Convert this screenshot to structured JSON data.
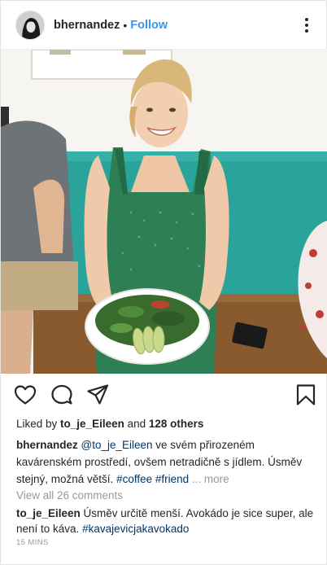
{
  "header": {
    "username": "bhernandez",
    "separator": "•",
    "follow_label": "Follow",
    "avatar_icon": "profile-avatar",
    "more_icon": "more-options-icon"
  },
  "photo": {
    "subject": "post-photo"
  },
  "actions": {
    "like_icon": "heart-icon",
    "comment_icon": "comment-icon",
    "share_icon": "send-icon",
    "save_icon": "bookmark-icon"
  },
  "likes": {
    "prefix": "Liked by ",
    "user": "to_je_Eileen",
    "middle": " and ",
    "others": "128 others"
  },
  "caption": {
    "author": "bhernandez",
    "mention": "@to_je_Eileen",
    "text": " ve svém přirozeném kavárenském prostředí, ovšem netradičně s jídlem. Úsměv stejný, možná větší. ",
    "tag1": "#coffee",
    "tag2": "#friend",
    "more": "... more"
  },
  "view_all": "View all 26 comments",
  "comment": {
    "author": "to_je_Eileen",
    "text": " Úsměv určitě menší. Avokádo je sice super, ale není to káva. ",
    "tag": "#kavajevicjakavokado"
  },
  "timestamp": "15 MINS",
  "colors": {
    "link_blue": "#3897f0",
    "hashtag": "#003569",
    "muted": "#999999",
    "text": "#262626"
  }
}
